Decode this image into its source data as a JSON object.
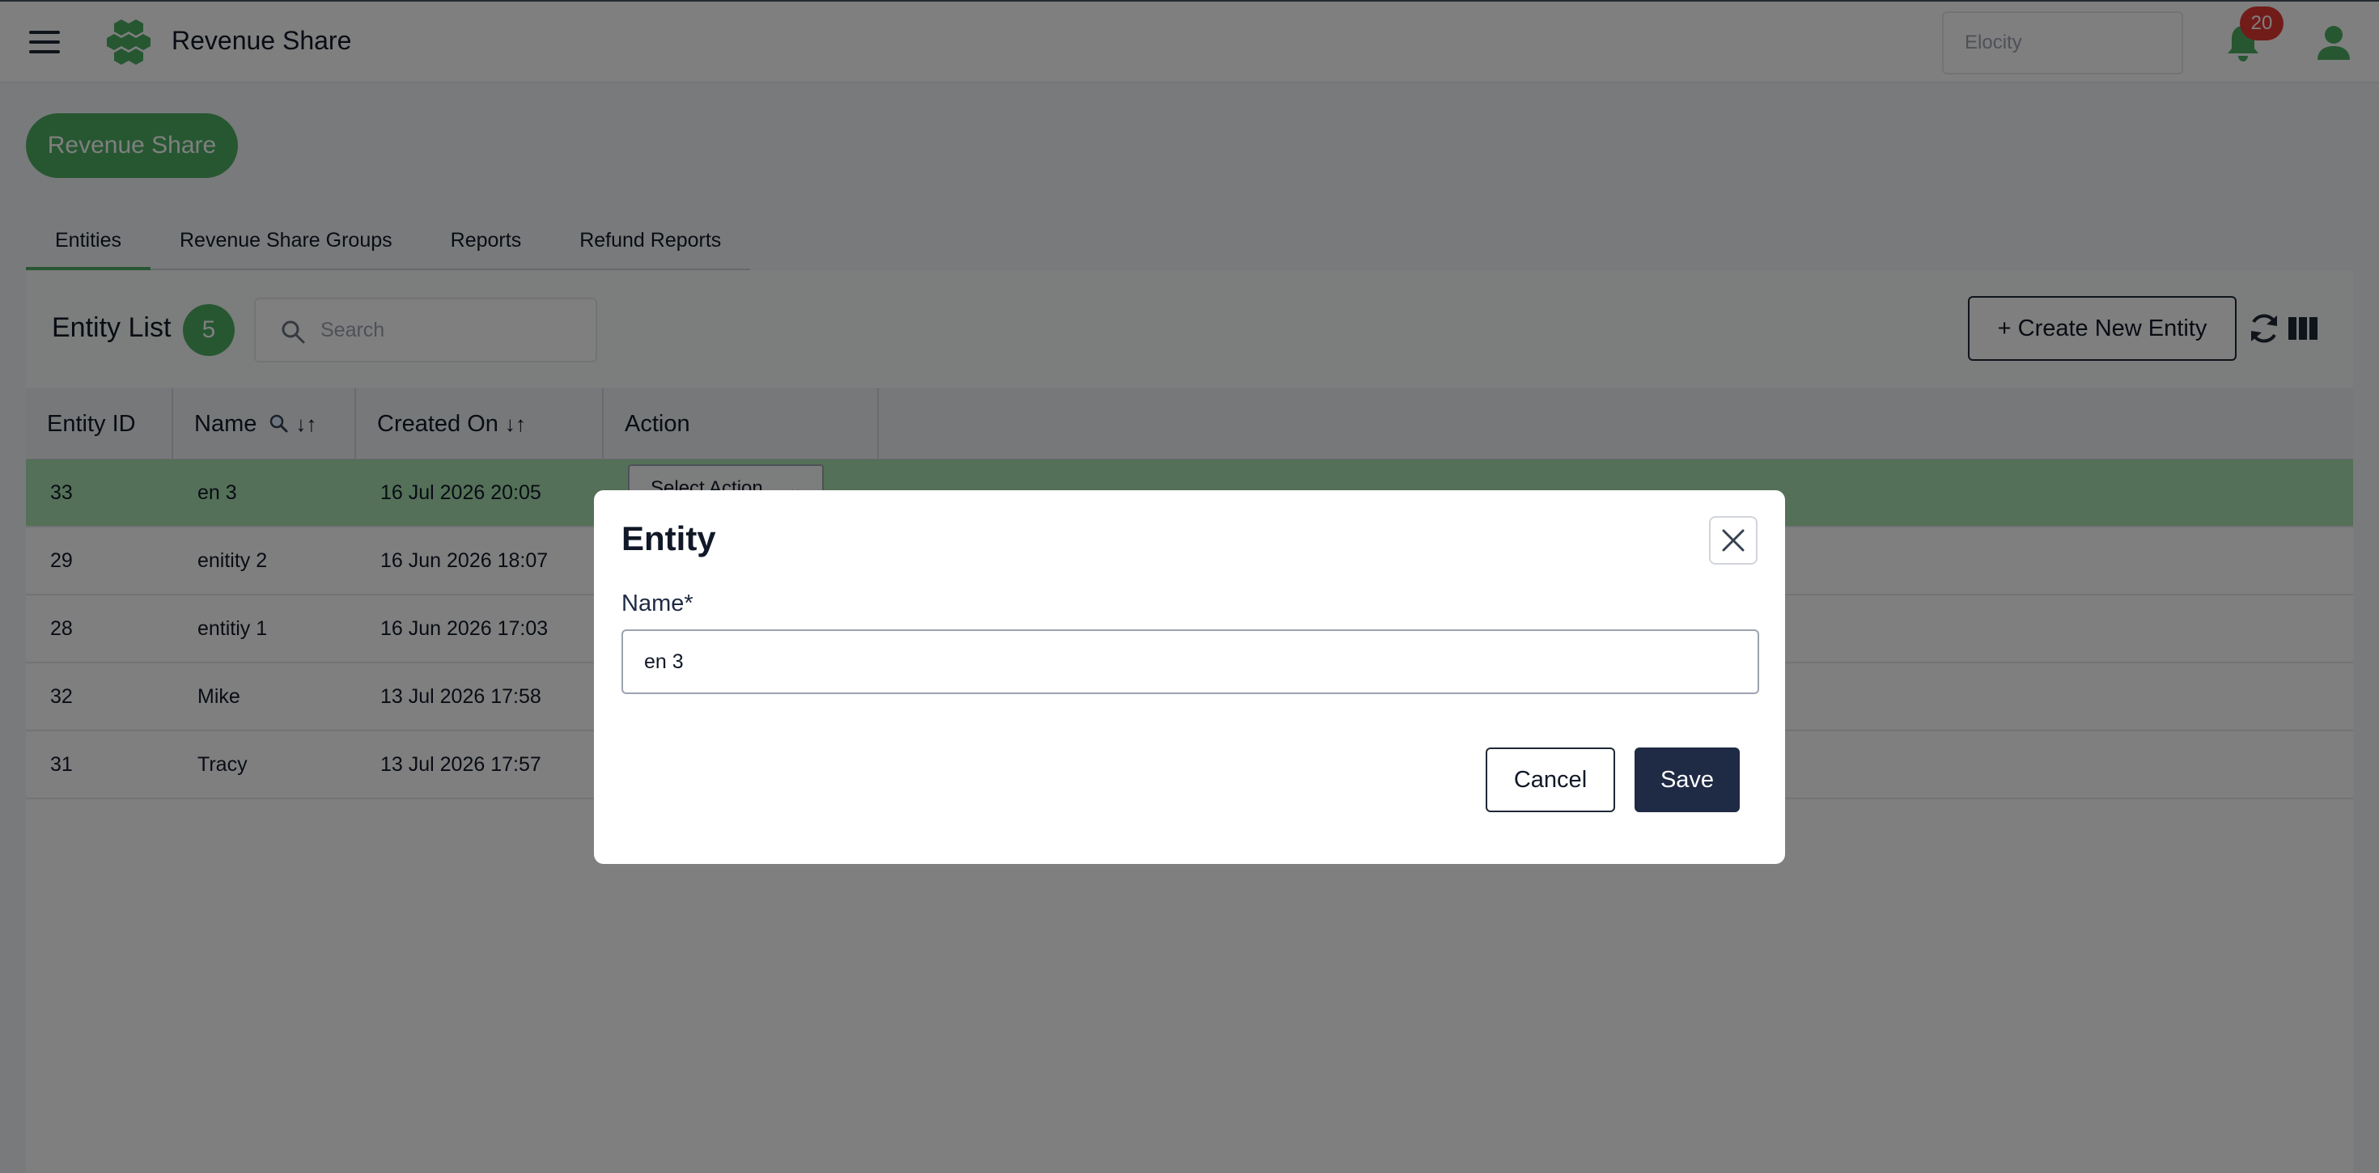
{
  "app": {
    "title": "Revenue Share",
    "search_placeholder": "Elocity",
    "notification_count": "20",
    "brand_color": "#4caf63",
    "icons": [
      "menu-icon",
      "logo-icon",
      "bell-icon",
      "user-icon"
    ]
  },
  "page": {
    "button_label": "Revenue Share"
  },
  "tabs": [
    {
      "label": "Entities",
      "active": true
    },
    {
      "label": "Revenue Share Groups",
      "active": false
    },
    {
      "label": "Reports",
      "active": false
    },
    {
      "label": "Refund Reports",
      "active": false
    }
  ],
  "entity_list": {
    "title": "Entity List",
    "count": "5",
    "search_placeholder": "Search",
    "create_label": "+ Create New Entity",
    "columns": {
      "id": "Entity ID",
      "name": "Name",
      "created": "Created On",
      "action": "Action",
      "sort_glyph": "↓↑"
    },
    "rows": [
      {
        "id": "33",
        "name": "en 3",
        "created": "16 Jul 2026 20:05",
        "selected": true
      },
      {
        "id": "29",
        "name": "enitity 2",
        "created": "16 Jun 2026 18:07",
        "selected": false
      },
      {
        "id": "28",
        "name": "entitiy 1",
        "created": "16 Jun 2026 17:03",
        "selected": false
      },
      {
        "id": "32",
        "name": "Mike",
        "created": "13 Jul 2026 17:58",
        "selected": false
      },
      {
        "id": "31",
        "name": "Tracy",
        "created": "13 Jul 2026 17:57",
        "selected": false
      }
    ],
    "select_action_label": "Select Action"
  },
  "modal": {
    "title": "Entity",
    "name_label": "Name*",
    "name_value": "en 3",
    "cancel_label": "Cancel",
    "save_label": "Save",
    "primary_color": "#1f2a44"
  }
}
